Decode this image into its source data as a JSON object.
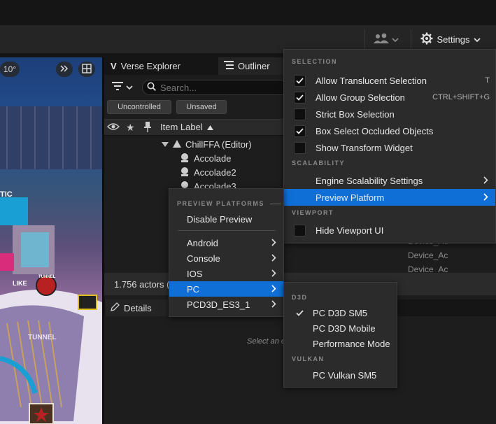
{
  "toolbar": {
    "users_icon": "users-icon",
    "settings_label": "Settings"
  },
  "viewport": {
    "fov": "10°",
    "signs": [
      "TIC",
      "TUNNEL",
      "LIKE",
      "TUNNEL"
    ]
  },
  "tabs": {
    "verse_explorer": "Verse Explorer",
    "outliner": "Outliner",
    "details": "Details"
  },
  "outliner": {
    "search_placeholder": "Search...",
    "filter_uncontrolled": "Uncontrolled",
    "filter_unsaved": "Unsaved",
    "column_item_label": "Item Label",
    "root_item": "ChillFFA (Editor)",
    "items": [
      "Accolade",
      "Accolade2",
      "Accolade3"
    ],
    "device_items": [
      "Device_Ac",
      "Device_Ac",
      "Device_Ac"
    ],
    "actor_count": "1.756 actors (",
    "details_hint": "Select an o"
  },
  "settings_menu": {
    "section_selection": "SELECTION",
    "allow_translucent": "Allow Translucent Selection",
    "allow_translucent_shortcut": "T",
    "allow_group": "Allow Group Selection",
    "allow_group_shortcut": "CTRL+SHIFT+G",
    "strict_box": "Strict Box Selection",
    "box_select_occluded": "Box Select Occluded Objects",
    "show_transform_widget": "Show Transform Widget",
    "section_scalability": "SCALABILITY",
    "engine_scalability": "Engine Scalability Settings",
    "preview_platform": "Preview Platform",
    "section_viewport": "VIEWPORT",
    "hide_viewport_ui": "Hide Viewport UI"
  },
  "platform_menu": {
    "section": "PREVIEW PLATFORMS",
    "disable_preview": "Disable Preview",
    "items": [
      "Android",
      "Console",
      "IOS",
      "PC",
      "PCD3D_ES3_1"
    ]
  },
  "pc_menu": {
    "section_d3d": "D3D",
    "pc_d3d_sm5": "PC D3D SM5",
    "pc_d3d_mobile": "PC D3D Mobile",
    "performance_mode": "Performance Mode",
    "section_vulkan": "VULKAN",
    "pc_vulkan_sm5": "PC Vulkan SM5"
  },
  "colors": {
    "highlight": "#0f6fd6",
    "menu_bg": "#2b2b2b",
    "panel_bg": "#1d1d1d"
  }
}
